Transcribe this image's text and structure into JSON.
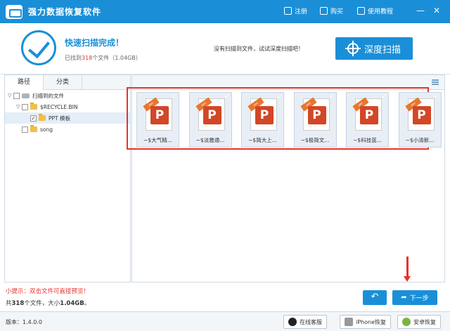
{
  "titlebar": {
    "app_title": "强力数据恢复软件",
    "register": "注册",
    "buy": "购买",
    "tutorial": "使用教程",
    "minimize": "—",
    "close": "✕"
  },
  "header": {
    "scan_title": "快速扫描完成！",
    "found_prefix": "已找到",
    "found_count": "318",
    "found_suffix": "个文件（1.04GB）",
    "hint": "没有扫描到文件，试试深度扫描吧！",
    "deep_scan_button": "深度扫描"
  },
  "left_panel": {
    "tabs": [
      "路径",
      "分类"
    ],
    "tree": [
      {
        "label": "扫描到的文件",
        "level": 0,
        "checked": false,
        "twist": "▽"
      },
      {
        "label": "$RECYCLE.BIN",
        "level": 1,
        "checked": false,
        "twist": "▽"
      },
      {
        "label": "PPT 模板",
        "level": 2,
        "checked": true,
        "twist": ""
      },
      {
        "label": "song",
        "level": 1,
        "checked": false,
        "twist": ""
      }
    ]
  },
  "files": [
    {
      "name": "~$大气精..."
    },
    {
      "name": "~$淡雅通..."
    },
    {
      "name": "~$简大上..."
    },
    {
      "name": "~$极简文..."
    },
    {
      "name": "~$科技蓝..."
    },
    {
      "name": "~$小清新..."
    }
  ],
  "file_badge": "PPT",
  "file_logo": "P",
  "bottom": {
    "tip": "小提示：双击文件可直接预览！",
    "summary_prefix": "共",
    "summary_count": "318",
    "summary_mid": "个文件，大小",
    "summary_size": "1.04GB",
    "summary_suffix": "。",
    "back_icon": "↶",
    "next_label": "下一步"
  },
  "statusbar": {
    "version": "版本：1.4.0.0",
    "online_service": "在线客服",
    "iphone_recovery": "iPhone恢复",
    "android_recovery": "安卓恢复"
  },
  "colors": {
    "accent": "#1a8fd8",
    "highlight": "#e8322d",
    "ppt": "#d24726"
  }
}
